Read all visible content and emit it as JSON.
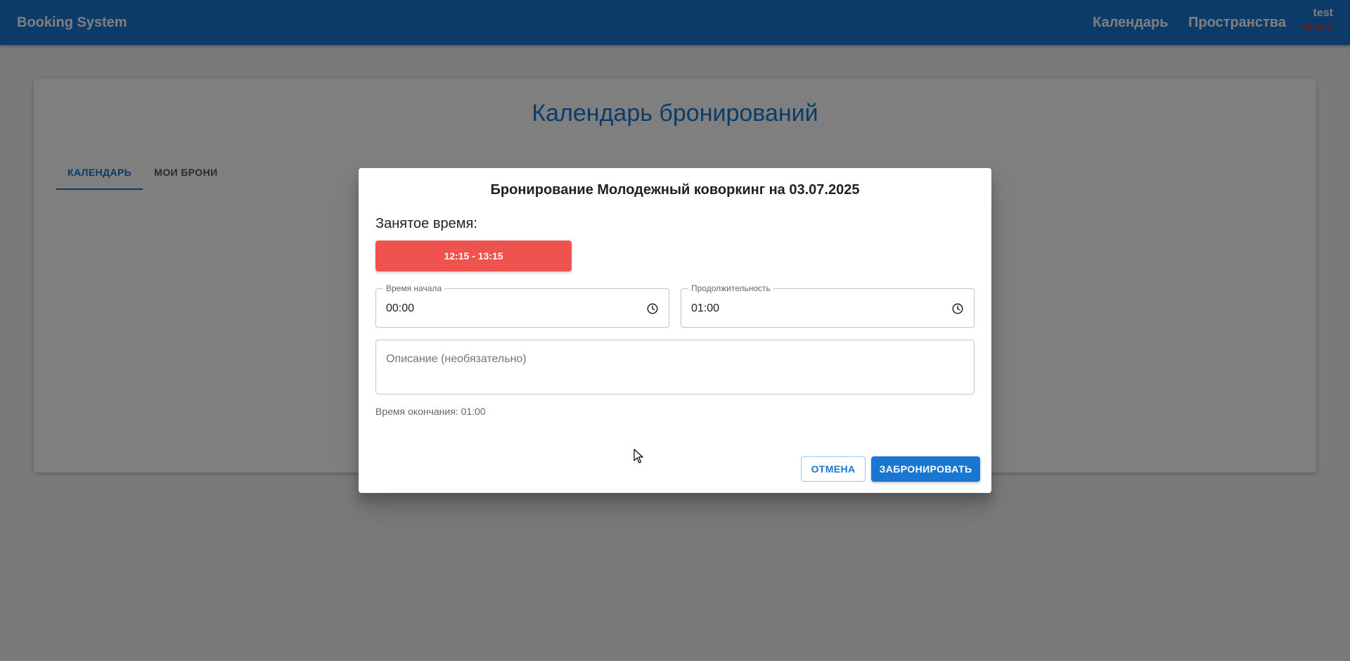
{
  "header": {
    "brand": "Booking System",
    "nav": [
      {
        "label": "Календарь"
      },
      {
        "label": "Пространства"
      }
    ],
    "user": {
      "name": "test",
      "logout_label": "Выйти"
    }
  },
  "main": {
    "title": "Календарь бронирований",
    "tabs": [
      {
        "label": "КАЛЕНДАРЬ",
        "active": true
      },
      {
        "label": "МОИ БРОНИ",
        "active": false
      }
    ]
  },
  "dialog": {
    "title": "Бронирование Молодежный коворкинг на 03.07.2025",
    "busy_label": "Занятое время:",
    "busy_slots": [
      "12:15 - 13:15"
    ],
    "start_field": {
      "label": "Время начала",
      "value": "00:00",
      "icon": "clock-icon"
    },
    "duration_field": {
      "label": "Продолжительность",
      "value": "01:00",
      "icon": "clock-icon"
    },
    "description_field": {
      "placeholder": "Описание (необязательно)",
      "value": ""
    },
    "end_time_text": "Время окончания: 01:00",
    "cancel_label": "ОТМЕНА",
    "submit_label": "ЗАБРОНИРОВАТЬ"
  },
  "colors": {
    "primary": "#1976d2",
    "busy": "#ef5350",
    "logout": "#d32f2f"
  }
}
